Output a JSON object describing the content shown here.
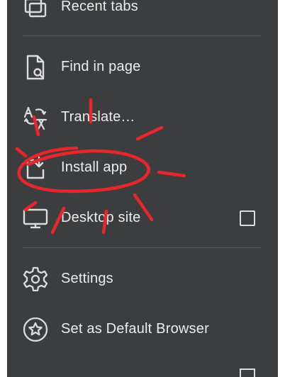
{
  "menu": {
    "recent_tabs": {
      "label": "Recent tabs",
      "icon": "recent-tabs-icon"
    },
    "find_in_page": {
      "label": "Find in page",
      "icon": "find-in-page-icon"
    },
    "translate": {
      "label": "Translate…",
      "icon": "translate-icon"
    },
    "install_app": {
      "label": "Install app",
      "icon": "install-app-icon"
    },
    "desktop_site": {
      "label": "Desktop site",
      "icon": "desktop-icon",
      "checked": false
    },
    "settings": {
      "label": "Settings",
      "icon": "gear-icon"
    },
    "default_browser": {
      "label": "Set as Default Browser",
      "icon": "star-badge-icon"
    }
  },
  "colors": {
    "menu_background": "#3c3d3f",
    "text": "#ececec",
    "divider": "#545558",
    "annotation": "#e8262c"
  }
}
